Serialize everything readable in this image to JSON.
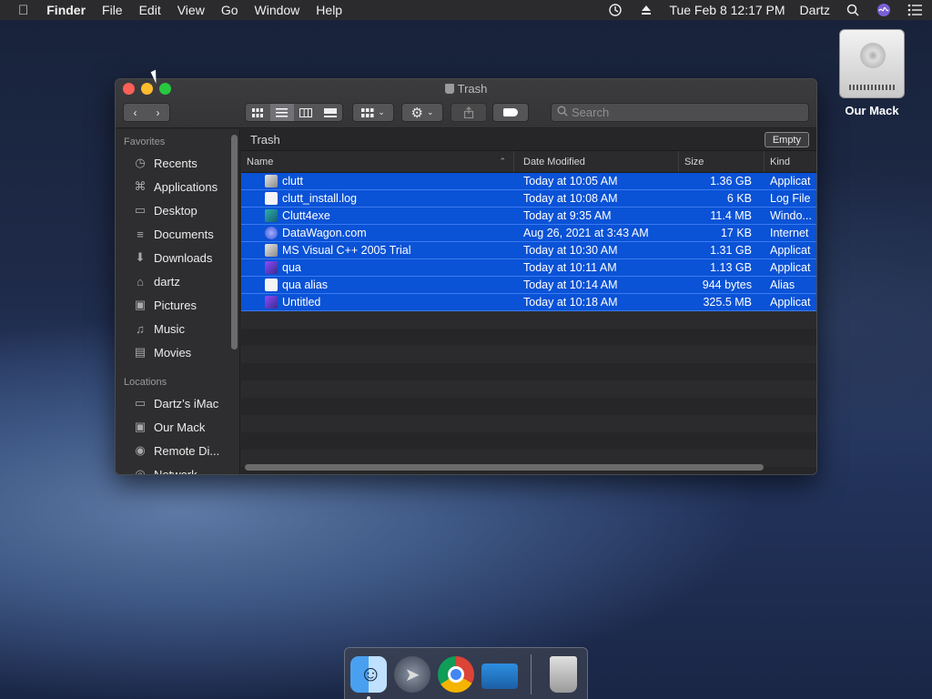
{
  "menubar": {
    "app": "Finder",
    "items": [
      "File",
      "Edit",
      "View",
      "Go",
      "Window",
      "Help"
    ],
    "datetime": "Tue Feb 8  12:17 PM",
    "user": "Dartz"
  },
  "desktop": {
    "drive_label": "Our Mack"
  },
  "window": {
    "title": "Trash",
    "search_placeholder": "Search",
    "path_title": "Trash",
    "empty_label": "Empty",
    "columns": {
      "name": "Name",
      "date": "Date Modified",
      "size": "Size",
      "kind": "Kind"
    },
    "rows": [
      {
        "name": "clutt",
        "date": "Today at 10:05 AM",
        "size": "1.36 GB",
        "kind": "Applicat",
        "icon": "app-icon"
      },
      {
        "name": "clutt_install.log",
        "date": "Today at 10:08 AM",
        "size": "6 KB",
        "kind": "Log File",
        "icon": "document-icon"
      },
      {
        "name": "Clutt4exe",
        "date": "Today at 9:35 AM",
        "size": "11.4 MB",
        "kind": "Windo...",
        "icon": "window-app-icon"
      },
      {
        "name": "DataWagon.com",
        "date": "Aug 26, 2021 at 3:43 AM",
        "size": "17 KB",
        "kind": "Internet",
        "icon": "globe-icon"
      },
      {
        "name": "MS Visual C++ 2005 Trial",
        "date": "Today at 10:30 AM",
        "size": "1.31 GB",
        "kind": "Applicat",
        "icon": "app-icon"
      },
      {
        "name": "qua",
        "date": "Today at 10:11 AM",
        "size": "1.13 GB",
        "kind": "Applicat",
        "icon": "purple-app-icon"
      },
      {
        "name": "qua alias",
        "date": "Today at 10:14 AM",
        "size": "944 bytes",
        "kind": "Alias",
        "icon": "alias-icon"
      },
      {
        "name": "Untitled",
        "date": "Today at 10:18 AM",
        "size": "325.5 MB",
        "kind": "Applicat",
        "icon": "purple-app-icon"
      }
    ]
  },
  "sidebar": {
    "favorites_label": "Favorites",
    "favorites": [
      {
        "label": "Recents",
        "icon": "clock-icon"
      },
      {
        "label": "Applications",
        "icon": "applications-icon"
      },
      {
        "label": "Desktop",
        "icon": "desktop-icon"
      },
      {
        "label": "Documents",
        "icon": "documents-icon"
      },
      {
        "label": "Downloads",
        "icon": "downloads-icon"
      },
      {
        "label": "dartz",
        "icon": "home-icon"
      },
      {
        "label": "Pictures",
        "icon": "camera-icon"
      },
      {
        "label": "Music",
        "icon": "music-icon"
      },
      {
        "label": "Movies",
        "icon": "film-icon"
      }
    ],
    "locations_label": "Locations",
    "locations": [
      {
        "label": "Dartz’s iMac",
        "icon": "imac-icon"
      },
      {
        "label": "Our Mack",
        "icon": "drive-icon"
      },
      {
        "label": "Remote Di...",
        "icon": "disc-icon"
      },
      {
        "label": "Network",
        "icon": "globe-icon"
      }
    ]
  },
  "dock": [
    "Finder",
    "Launchpad",
    "Google Chrome",
    "Screen",
    "Trash"
  ],
  "colors": {
    "selection": "#0a52d6",
    "accent": "#3b7bf0"
  }
}
